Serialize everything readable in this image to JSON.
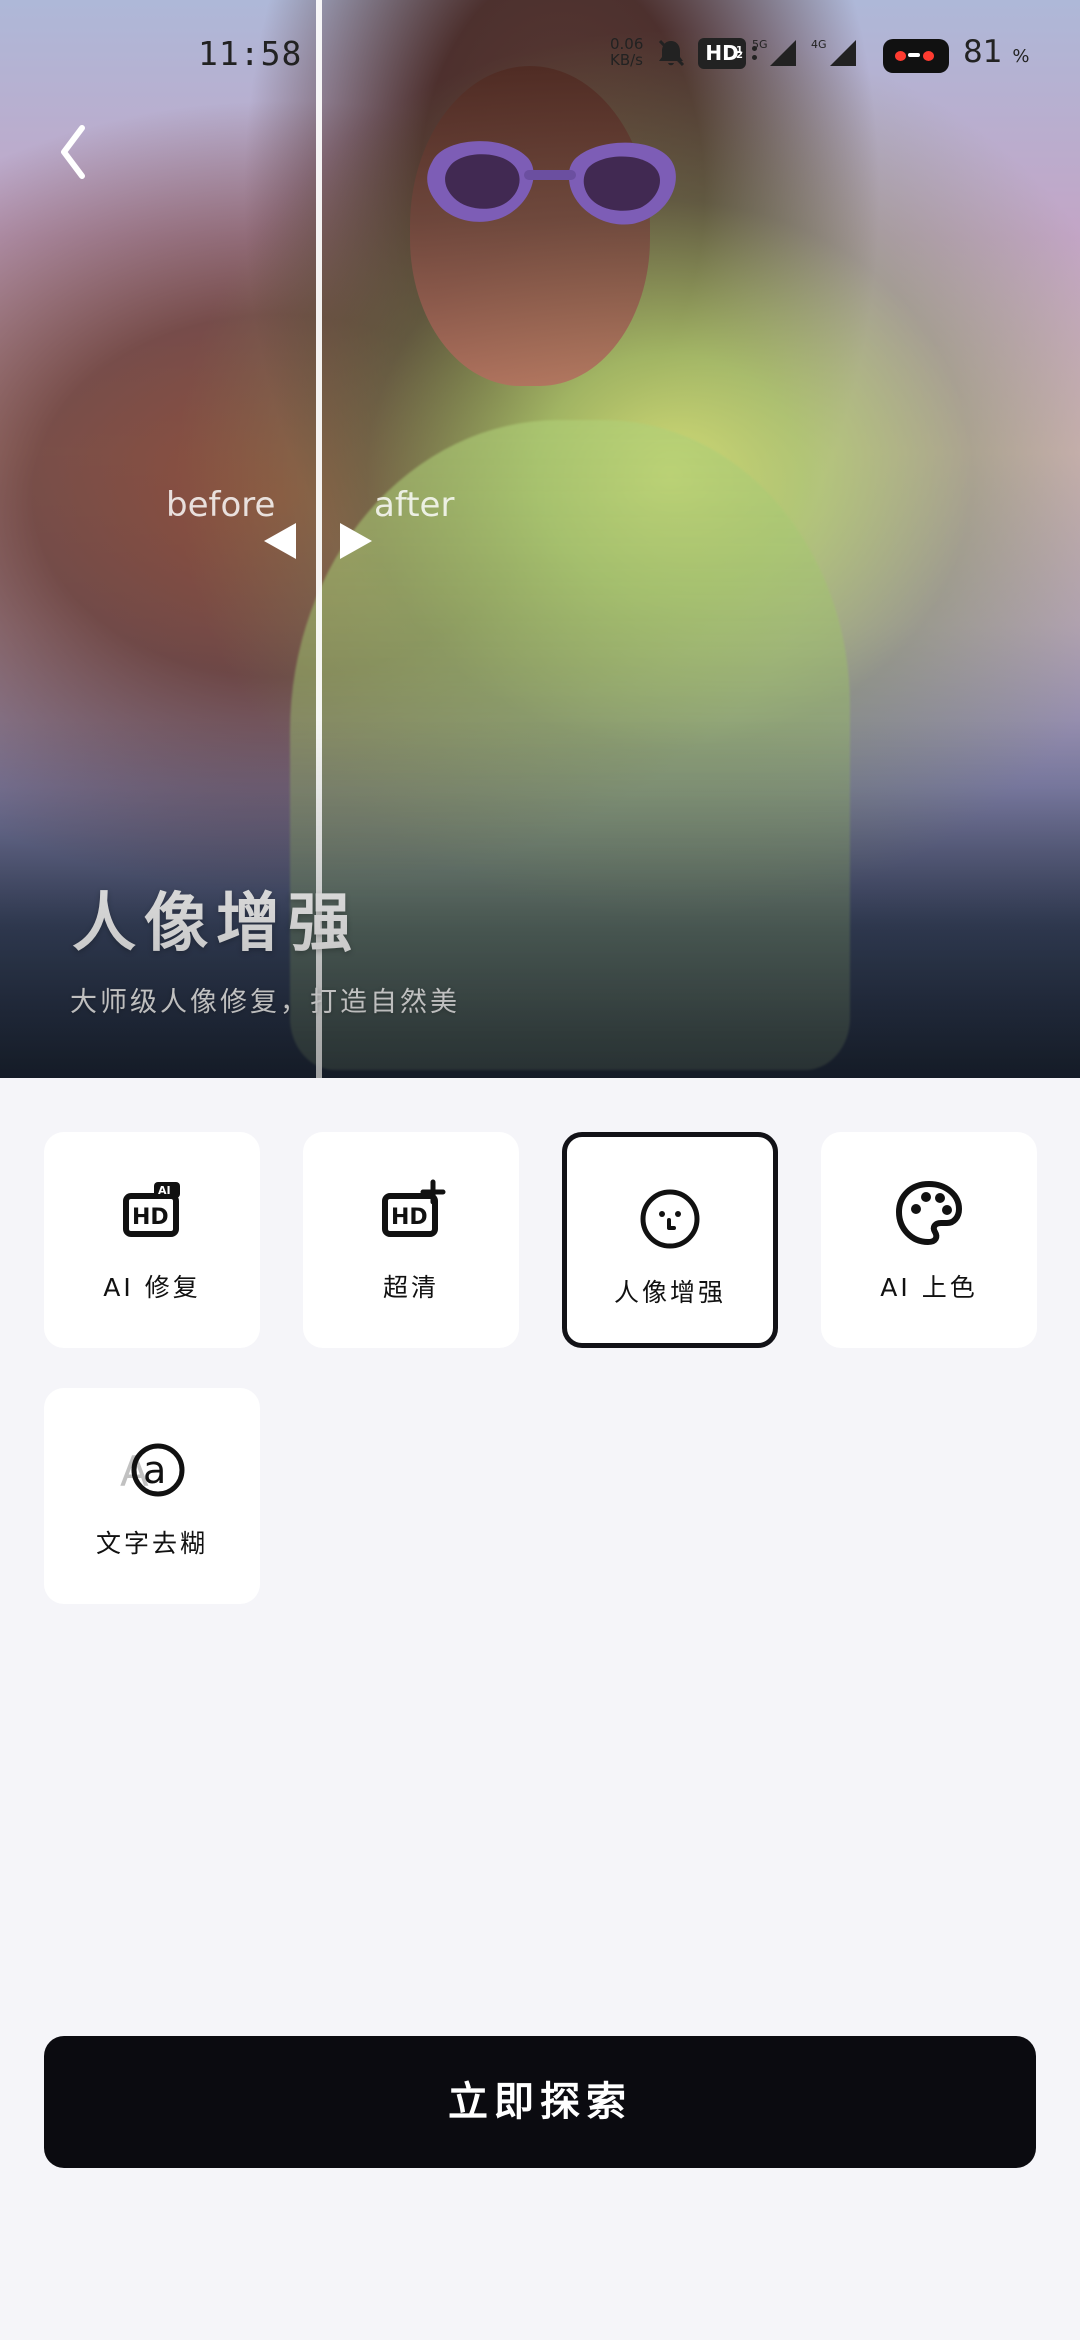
{
  "status_bar": {
    "time": "11:58",
    "network_speed_top": "0.06",
    "network_speed_bottom": "KB/s",
    "hd_label": "HD",
    "hd_sup": "1",
    "hd_sub": "2",
    "signal_1_label": "5G",
    "signal_2_label": "4G",
    "battery_percent": "81",
    "battery_symbol": "%"
  },
  "hero": {
    "before_label": "before",
    "after_label": "after",
    "title": "人像增强",
    "subtitle": "大师级人像修复，打造自然美"
  },
  "tools": [
    {
      "label": "AI 修复",
      "icon": "hd-ai-icon",
      "selected": false
    },
    {
      "label": "超清",
      "icon": "hd-plus-icon",
      "selected": false
    },
    {
      "label": "人像增强",
      "icon": "face-icon",
      "selected": true
    },
    {
      "label": "AI 上色",
      "icon": "palette-icon",
      "selected": false
    },
    {
      "label": "文字去糊",
      "icon": "text-deblur-icon",
      "selected": false
    }
  ],
  "actions": {
    "explore": "立即探索"
  },
  "colors": {
    "accent": "#0b0b10",
    "card_background": "#ffffff",
    "page_background": "#f5f5f9"
  }
}
